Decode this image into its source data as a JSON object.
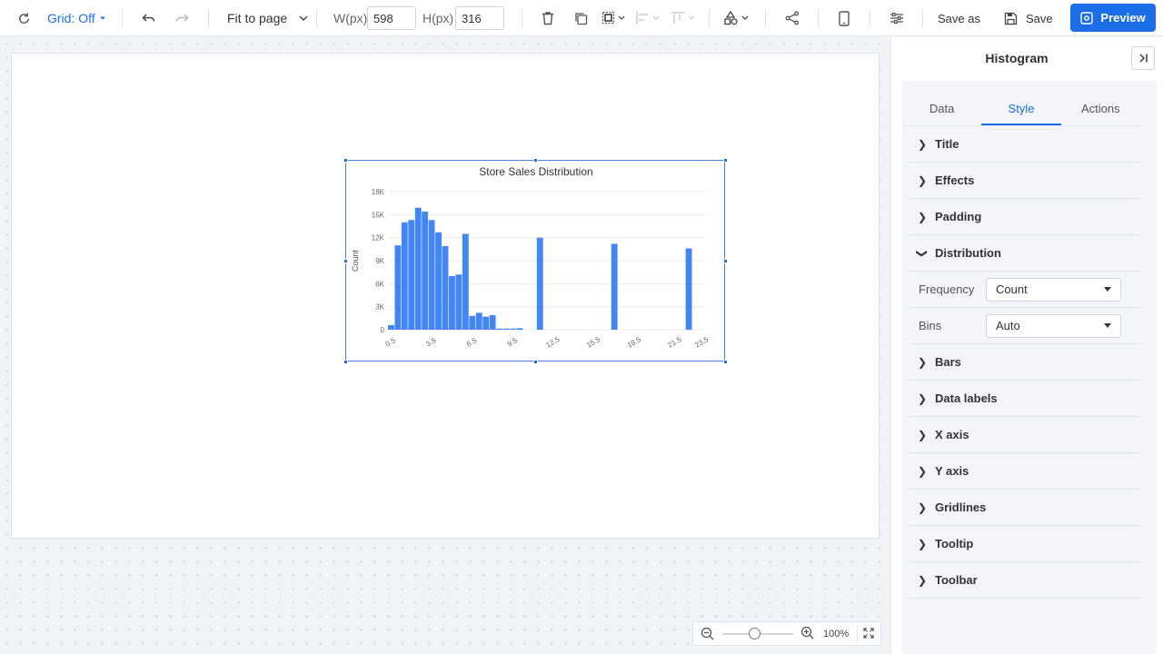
{
  "toolbar": {
    "grid_label": "Grid: Off",
    "fit_label": "Fit to page",
    "width_label": "W(px)",
    "width_value": "598",
    "height_label": "H(px)",
    "height_value": "316",
    "save_as_label": "Save as",
    "save_label": "Save",
    "preview_label": "Preview"
  },
  "panel": {
    "title": "Histogram",
    "tabs": [
      {
        "label": "Data",
        "active": false
      },
      {
        "label": "Style",
        "active": true
      },
      {
        "label": "Actions",
        "active": false
      }
    ],
    "sections": {
      "title": "Title",
      "effects": "Effects",
      "padding": "Padding",
      "distribution": "Distribution",
      "bars": "Bars",
      "data_labels": "Data labels",
      "x_axis": "X axis",
      "y_axis": "Y axis",
      "gridlines": "Gridlines",
      "tooltip": "Tooltip",
      "toolbar": "Toolbar"
    },
    "distribution": {
      "frequency_label": "Frequency",
      "frequency_value": "Count",
      "bins_label": "Bins",
      "bins_value": "Auto"
    }
  },
  "zoom": {
    "level": "100%",
    "slider_fraction": 0.45
  },
  "colors": {
    "accent": "#1c6ee8",
    "bar": "#4285f4"
  },
  "chart_data": {
    "type": "bar",
    "title": "Store Sales Distribution",
    "xlabel": "",
    "ylabel": "Count",
    "ylim": [
      0,
      18000
    ],
    "yticks": [
      "0",
      "3K",
      "6K",
      "9K",
      "12K",
      "15K",
      "18K"
    ],
    "xticks": [
      "0.5",
      "3.5",
      "6.5",
      "9.5",
      "12.5",
      "15.5",
      "18.5",
      "21.5",
      "23.5"
    ],
    "grid": true,
    "bins": [
      {
        "x0": 0.5,
        "x1": 1.0,
        "count": 600
      },
      {
        "x0": 1.0,
        "x1": 1.5,
        "count": 11000
      },
      {
        "x0": 1.5,
        "x1": 2.0,
        "count": 14000
      },
      {
        "x0": 2.0,
        "x1": 2.5,
        "count": 14300
      },
      {
        "x0": 2.5,
        "x1": 3.0,
        "count": 15900
      },
      {
        "x0": 3.0,
        "x1": 3.5,
        "count": 15400
      },
      {
        "x0": 3.5,
        "x1": 4.0,
        "count": 14300
      },
      {
        "x0": 4.0,
        "x1": 4.5,
        "count": 12700
      },
      {
        "x0": 4.5,
        "x1": 5.0,
        "count": 10900
      },
      {
        "x0": 5.0,
        "x1": 5.5,
        "count": 7000
      },
      {
        "x0": 5.5,
        "x1": 6.0,
        "count": 7200
      },
      {
        "x0": 6.0,
        "x1": 6.5,
        "count": 12500
      },
      {
        "x0": 6.5,
        "x1": 7.0,
        "count": 1800
      },
      {
        "x0": 7.0,
        "x1": 7.5,
        "count": 2200
      },
      {
        "x0": 7.5,
        "x1": 8.0,
        "count": 1700
      },
      {
        "x0": 8.0,
        "x1": 8.5,
        "count": 1900
      },
      {
        "x0": 8.5,
        "x1": 9.0,
        "count": 150
      },
      {
        "x0": 9.0,
        "x1": 9.5,
        "count": 150
      },
      {
        "x0": 9.5,
        "x1": 10.0,
        "count": 150
      },
      {
        "x0": 10.0,
        "x1": 10.5,
        "count": 200
      },
      {
        "x0": 11.5,
        "x1": 12.0,
        "count": 12000
      },
      {
        "x0": 17.0,
        "x1": 17.5,
        "count": 11200
      },
      {
        "x0": 22.5,
        "x1": 23.0,
        "count": 10600
      }
    ]
  }
}
